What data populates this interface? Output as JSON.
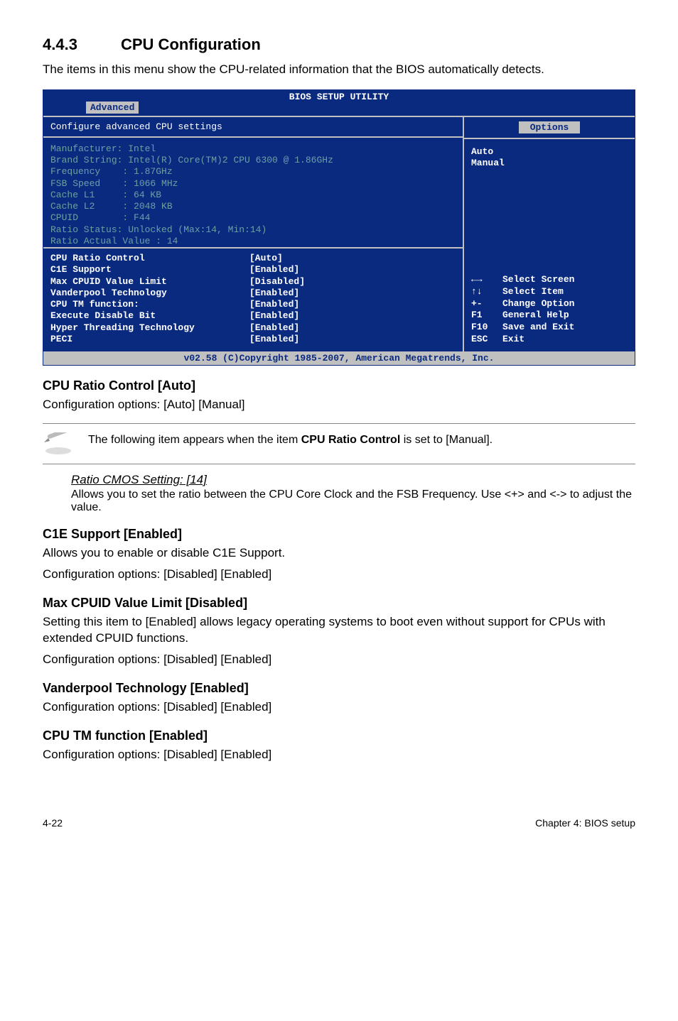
{
  "section": {
    "number": "4.4.3",
    "title": "CPU Configuration"
  },
  "intro": "The items in this menu show the CPU-related information that the BIOS automatically detects.",
  "bios": {
    "title": "BIOS SETUP UTILITY",
    "tab": "Advanced",
    "left_heading": "Configure advanced CPU settings",
    "options_label": "Options",
    "info_lines": "Manufacturer: Intel\nBrand String: Intel(R) Core(TM)2 CPU 6300 @ 1.86GHz\nFrequency    : 1.87GHz\nFSB Speed    : 1066 MHz\nCache L1     : 64 KB\nCache L2     : 2048 KB\nCPUID        : F44\nRatio Status: Unlocked (Max:14, Min:14)\nRatio Actual Value : 14",
    "settings": [
      {
        "label": "CPU Ratio Control",
        "value": "[Auto]"
      },
      {
        "label": "C1E Support",
        "value": "[Enabled]"
      },
      {
        "label": "Max CPUID Value Limit",
        "value": "[Disabled]"
      },
      {
        "label": "Vanderpool Technology",
        "value": "[Enabled]"
      },
      {
        "label": "CPU TM function:",
        "value": "[Enabled]"
      },
      {
        "label": "Execute Disable Bit",
        "value": "[Enabled]"
      },
      {
        "label": "Hyper Threading Technology",
        "value": "[Enabled]"
      },
      {
        "label": "PECI",
        "value": "[Enabled]"
      }
    ],
    "right_options": [
      "Auto",
      "Manual"
    ],
    "help": [
      {
        "key_class": "harrow-lr",
        "key": "",
        "desc": "Select Screen"
      },
      {
        "key_class": "harrow-ud",
        "key": "",
        "desc": "Select Item"
      },
      {
        "key_class": "",
        "key": "+-",
        "desc": "Change Option"
      },
      {
        "key_class": "",
        "key": "F1",
        "desc": "General Help"
      },
      {
        "key_class": "",
        "key": "F10",
        "desc": "Save and Exit"
      },
      {
        "key_class": "",
        "key": "ESC",
        "desc": "Exit"
      }
    ],
    "footer": "v02.58 (C)Copyright 1985-2007, American Megatrends, Inc."
  },
  "subs": {
    "cpu_ratio": {
      "heading": "CPU Ratio Control [Auto]",
      "text": "Configuration options: [Auto] [Manual]"
    },
    "note": {
      "pre": "The following item appears when the item ",
      "bold": "CPU Ratio Control",
      "post": " is set to [Manual]."
    },
    "ratio_cmos": {
      "heading": "Ratio CMOS Setting: [14]",
      "text": "Allows you to set the ratio between the CPU Core Clock and the FSB Frequency. Use <+> and <-> to adjust the value."
    },
    "c1e": {
      "heading": "C1E Support [Enabled]",
      "text1": "Allows you to enable or disable C1E Support.",
      "text2": "Configuration options: [Disabled] [Enabled]"
    },
    "max_cpuid": {
      "heading": "Max CPUID Value Limit [Disabled]",
      "text1": "Setting this item to [Enabled] allows legacy operating systems to boot even without support for CPUs with extended CPUID functions.",
      "text2": "Configuration options: [Disabled] [Enabled]"
    },
    "vanderpool": {
      "heading": "Vanderpool Technology [Enabled]",
      "text": "Configuration options: [Disabled] [Enabled]"
    },
    "cpu_tm": {
      "heading": "CPU TM function [Enabled]",
      "text": "Configuration options: [Disabled] [Enabled]"
    }
  },
  "footer": {
    "left": "4-22",
    "right": "Chapter 4: BIOS setup"
  }
}
